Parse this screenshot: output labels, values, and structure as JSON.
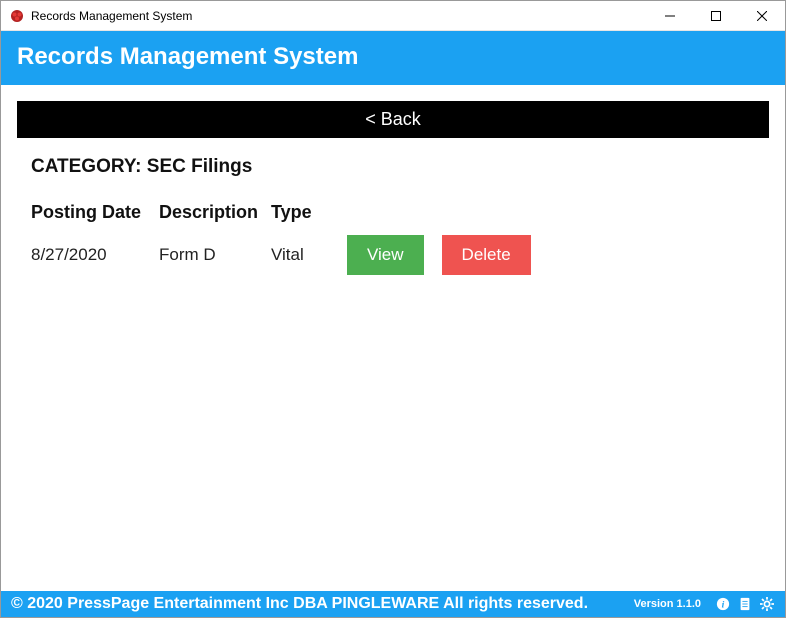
{
  "titlebar": {
    "title": "Records Management System"
  },
  "header": {
    "title": "Records Management System"
  },
  "content": {
    "back_label": "< Back",
    "category_prefix": "CATEGORY: ",
    "category_name": "SEC Filings",
    "columns": {
      "posting_date": "Posting Date",
      "description": "Description",
      "type": "Type"
    },
    "rows": [
      {
        "posting_date": "8/27/2020",
        "description": "Form D",
        "type": "Vital",
        "view_label": "View",
        "delete_label": "Delete"
      }
    ]
  },
  "footer": {
    "copyright": "© 2020 PressPage Entertainment Inc DBA PINGLEWARE  All rights reserved.",
    "version": "Version 1.1.0"
  }
}
